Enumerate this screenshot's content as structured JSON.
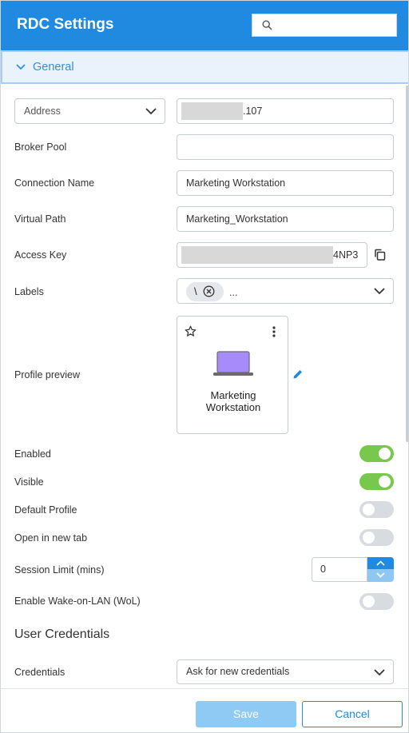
{
  "header": {
    "title": "RDC Settings",
    "search_placeholder": ""
  },
  "section": {
    "label": "General"
  },
  "address": {
    "type_label": "Address",
    "value_suffix": ".107"
  },
  "fields": {
    "broker_pool": {
      "label": "Broker Pool",
      "value": ""
    },
    "connection_name": {
      "label": "Connection Name",
      "value": "Marketing Workstation"
    },
    "virtual_path": {
      "label": "Virtual Path",
      "value": "Marketing_Workstation"
    },
    "access_key": {
      "label": "Access Key",
      "value_suffix": "4NP3"
    },
    "labels": {
      "label": "Labels",
      "chip_text": "\\",
      "overflow": "..."
    }
  },
  "profile_preview": {
    "label": "Profile preview",
    "card_name": "Marketing Workstation"
  },
  "toggles": [
    {
      "label": "Enabled",
      "on": true
    },
    {
      "label": "Visible",
      "on": true
    },
    {
      "label": "Default Profile",
      "on": false
    },
    {
      "label": "Open in new tab",
      "on": false
    }
  ],
  "session_limit": {
    "label": "Session Limit (mins)",
    "value": "0"
  },
  "wake_on_lan": {
    "label": "Enable Wake-on-LAN (WoL)",
    "on": false
  },
  "user_credentials": {
    "heading": "User Credentials",
    "credentials_label": "Credentials",
    "credentials_value": "Ask for new credentials"
  },
  "footer": {
    "save_label": "Save",
    "cancel_label": "Cancel"
  },
  "colors": {
    "accent": "#1f8ae0",
    "toggle_on": "#79c84e",
    "toggle_off": "#d8dbdf",
    "laptop": "#a78bfa"
  }
}
